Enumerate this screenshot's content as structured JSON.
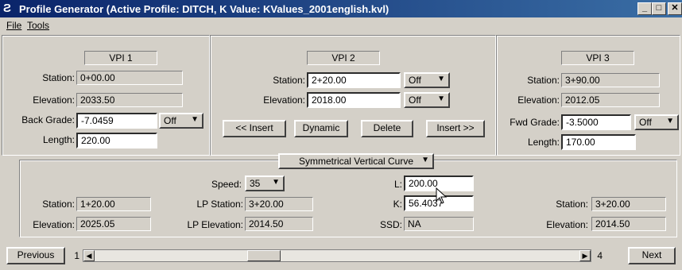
{
  "window": {
    "title": "Profile Generator  (Active Profile: DITCH,  K Value: KValues_2001english.kvl)",
    "minimize_glyph": "_",
    "maximize_glyph": "□",
    "close_glyph": "✕"
  },
  "menu": {
    "file": "File",
    "tools": "Tools"
  },
  "vpi1": {
    "name": "VPI 1",
    "station_label": "Station:",
    "station": "0+00.00",
    "elevation_label": "Elevation:",
    "elevation": "2033.50",
    "grade_label": "Back Grade:",
    "grade": "-7.0459",
    "grade_mode": "Off",
    "length_label": "Length:",
    "length": "220.00"
  },
  "vpi2": {
    "name": "VPI 2",
    "station_label": "Station:",
    "station": "2+20.00",
    "station_mode": "Off",
    "elevation_label": "Elevation:",
    "elevation": "2018.00",
    "elevation_mode": "Off",
    "buttons": {
      "insert_before": "<< Insert",
      "dynamic": "Dynamic",
      "delete": "Delete",
      "insert_after": "Insert >>"
    }
  },
  "vpi3": {
    "name": "VPI 3",
    "station_label": "Station:",
    "station": "3+90.00",
    "elevation_label": "Elevation:",
    "elevation": "2012.05",
    "grade_label": "Fwd Grade:",
    "grade": "-3.5000",
    "grade_mode": "Off",
    "length_label": "Length:",
    "length": "170.00"
  },
  "curve": {
    "type": "Symmetrical Vertical Curve",
    "speed_label": "Speed:",
    "speed": "35",
    "l_label": "L:",
    "l_value": "200.00",
    "k_label": "K:",
    "k_value": "56.4037",
    "ssd_label": "SSD:",
    "ssd_value": "NA",
    "lp_station_label": "LP Station:",
    "lp_station": "3+20.00",
    "lp_elevation_label": "LP Elevation:",
    "lp_elevation": "2014.50",
    "left_station_label": "Station:",
    "left_station": "1+20.00",
    "left_elevation_label": "Elevation:",
    "left_elevation": "2025.05",
    "right_station_label": "Station:",
    "right_station": "3+20.00",
    "right_elevation_label": "Elevation:",
    "right_elevation": "2014.50"
  },
  "nav": {
    "previous": "Previous",
    "current_index": "1",
    "total": "4",
    "next": "Next"
  }
}
